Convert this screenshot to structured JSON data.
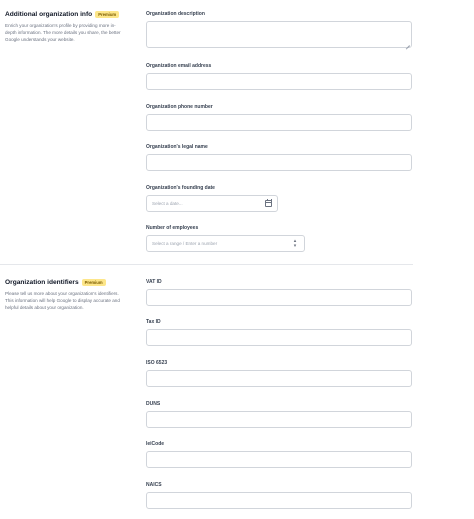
{
  "additional": {
    "title": "Additional organization info",
    "badge": "Premium",
    "description": "Enrich your organization's profile by providing more in-depth information. The more details you share, the better Google understands your website.",
    "fields": {
      "org_description": {
        "label": "Organization description",
        "value": ""
      },
      "email": {
        "label": "Organization email address",
        "value": ""
      },
      "phone": {
        "label": "Organization phone number",
        "value": ""
      },
      "legal_name": {
        "label": "Organization's legal name",
        "value": ""
      },
      "founding_date": {
        "label": "Organization's founding date",
        "placeholder": "Select a date..."
      },
      "employees": {
        "label": "Number of employees",
        "placeholder": "Select a range / Enter a number"
      }
    }
  },
  "identifiers": {
    "title": "Organization identifiers",
    "badge": "Premium",
    "description": "Please tell us more about your organization's identifiers. This information will help Google to display accurate and helpful details about your organization.",
    "fields": {
      "vat": {
        "label": "VAT ID",
        "value": ""
      },
      "tax": {
        "label": "Tax ID",
        "value": ""
      },
      "iso": {
        "label": "ISO 6523",
        "value": ""
      },
      "duns": {
        "label": "DUNS",
        "value": ""
      },
      "leicode": {
        "label": "leiCode",
        "value": ""
      },
      "naics": {
        "label": "NAICS",
        "value": ""
      }
    }
  },
  "icons": {
    "calendar": "calendar-icon",
    "select": "chevron-updown-icon"
  },
  "colors": {
    "badge_bg": "#fde68a",
    "badge_text": "#7a5b00",
    "border": "#d1d5db"
  }
}
